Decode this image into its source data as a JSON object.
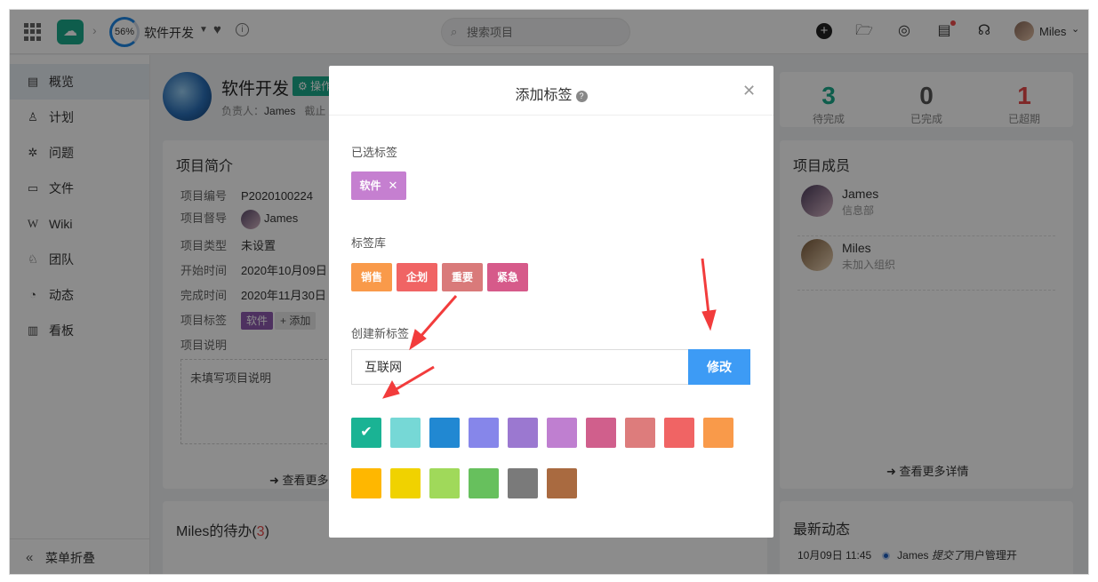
{
  "topbar": {
    "progress": "56%",
    "project_name": "软件开发",
    "search_placeholder": "搜索项目",
    "user_name": "Miles"
  },
  "sidebar": {
    "items": [
      {
        "label": "概览",
        "icon": "overview-icon",
        "active": true
      },
      {
        "label": "计划",
        "icon": "plan-icon"
      },
      {
        "label": "问题",
        "icon": "bug-icon"
      },
      {
        "label": "文件",
        "icon": "folder-icon"
      },
      {
        "label": "Wiki",
        "icon": "wiki-icon"
      },
      {
        "label": "团队",
        "icon": "team-icon"
      },
      {
        "label": "动态",
        "icon": "activity-icon"
      },
      {
        "label": "看板",
        "icon": "board-icon"
      }
    ],
    "collapse_label": "菜单折叠"
  },
  "project": {
    "title": "软件开发",
    "op_badge": "操作",
    "owner_label": "负责人：",
    "owner_name": "James",
    "deadline_label": "截止"
  },
  "intro": {
    "title": "项目简介",
    "rows": [
      {
        "k": "项目编号",
        "v": "P2020100224"
      },
      {
        "k": "项目督导",
        "v": "James"
      },
      {
        "k": "项目类型",
        "v": "未设置"
      },
      {
        "k": "开始时间",
        "v": "2020年10月09日"
      },
      {
        "k": "完成时间",
        "v": "2020年11月30日"
      },
      {
        "k": "项目标签",
        "v": ""
      },
      {
        "k": "项目说明",
        "v": ""
      }
    ],
    "tag": "软件",
    "tag_add": "+ 添加",
    "description": "未填写项目说明",
    "more": "查看更多"
  },
  "todo": {
    "title_prefix": "Miles的待办(",
    "count": "3",
    "title_suffix": ")"
  },
  "stats": [
    {
      "num": "3",
      "label": "待完成",
      "color": "#1aaa8a"
    },
    {
      "num": "0",
      "label": "已完成",
      "color": "#555555"
    },
    {
      "num": "1",
      "label": "已超期",
      "color": "#e84a4a"
    }
  ],
  "members": {
    "title": "项目成员",
    "list": [
      {
        "name": "James",
        "dept": "信息部"
      },
      {
        "name": "Miles",
        "dept": "未加入组织"
      }
    ],
    "more": "查看更多详情"
  },
  "feed": {
    "title": "最新动态",
    "time": "10月09日 11:45",
    "user": "James",
    "action": "提交了",
    "text": "用户管理开"
  },
  "modal": {
    "title": "添加标签",
    "selected_label": "已选标签",
    "selected_tag": {
      "label": "软件",
      "color": "#c57fd0"
    },
    "library_label": "标签库",
    "library": [
      {
        "label": "销售",
        "color": "#f99a4a"
      },
      {
        "label": "企划",
        "color": "#f06464"
      },
      {
        "label": "重要",
        "color": "#d97a7a"
      },
      {
        "label": "紧急",
        "color": "#d65a8a"
      }
    ],
    "create_label": "创建新标签",
    "input_value": "互联网",
    "modify_button": "修改",
    "colors": [
      "#1ab394",
      "#76d8d6",
      "#2188d2",
      "#8686ea",
      "#9b78d0",
      "#bf7fd0",
      "#d05f8c",
      "#dd7c7c",
      "#f06464",
      "#f99a4a",
      "#ffb700",
      "#f0d200",
      "#a0d95a",
      "#67c05d",
      "#7a7a7a",
      "#a96a40"
    ],
    "selected_color_index": 0
  }
}
